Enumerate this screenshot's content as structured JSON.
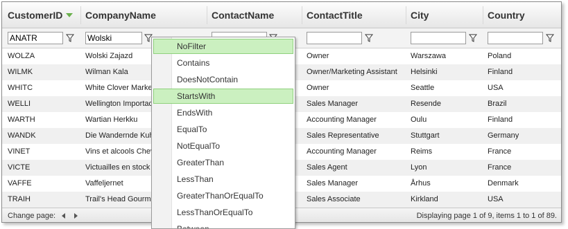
{
  "columns": [
    {
      "label": "CustomerID",
      "filter": "ANATR"
    },
    {
      "label": "CompanyName",
      "filter": "Wolski"
    },
    {
      "label": "ContactName",
      "filter": ""
    },
    {
      "label": "ContactTitle",
      "filter": ""
    },
    {
      "label": "City",
      "filter": ""
    },
    {
      "label": "Country",
      "filter": ""
    }
  ],
  "sort_indicator": "sort-descending-icon",
  "rows": [
    {
      "id": "WOLZA",
      "company": "Wolski Zajazd",
      "title": "Owner",
      "city": "Warszawa",
      "country": "Poland"
    },
    {
      "id": "WILMK",
      "company": "Wilman Kala",
      "title": "Owner/Marketing Assistant",
      "city": "Helsinki",
      "country": "Finland"
    },
    {
      "id": "WHITC",
      "company": "White Clover Markets",
      "title": "Owner",
      "city": "Seattle",
      "country": "USA"
    },
    {
      "id": "WELLI",
      "company": "Wellington Importadora",
      "title": "Sales Manager",
      "city": "Resende",
      "country": "Brazil"
    },
    {
      "id": "WARTH",
      "company": "Wartian Herkku",
      "title": "Accounting Manager",
      "city": "Oulu",
      "country": "Finland"
    },
    {
      "id": "WANDK",
      "company": "Die Wandernde Kuh",
      "title": "Sales Representative",
      "city": "Stuttgart",
      "country": "Germany"
    },
    {
      "id": "VINET",
      "company": "Vins et alcools Chevalier",
      "title": "Accounting Manager",
      "city": "Reims",
      "country": "France"
    },
    {
      "id": "VICTE",
      "company": "Victuailles en stock",
      "title": "Sales Agent",
      "city": "Lyon",
      "country": "France"
    },
    {
      "id": "VAFFE",
      "company": "Vaffeljernet",
      "title": "Sales Manager",
      "city": "Århus",
      "country": "Denmark"
    },
    {
      "id": "TRAIH",
      "company": "Trail's Head Gourmet Provisioners",
      "title": "Sales Associate",
      "city": "Kirkland",
      "country": "USA"
    }
  ],
  "pager": {
    "change_label": "Change page:",
    "status": "Displaying page 1 of 9, items 1 to 1 of 89."
  },
  "filter_menu": {
    "items": [
      "NoFilter",
      "Contains",
      "DoesNotContain",
      "StartsWith",
      "EndsWith",
      "EqualTo",
      "NotEqualTo",
      "GreaterThan",
      "LessThan",
      "GreaterThanOrEqualTo",
      "LessThanOrEqualTo",
      "Between"
    ],
    "highlighted": [
      "NoFilter",
      "StartsWith"
    ]
  },
  "colors": {
    "highlight": "#cbf0c0",
    "highlight_border": "#8fd17d",
    "sort_arrow": "#6ab04c"
  }
}
